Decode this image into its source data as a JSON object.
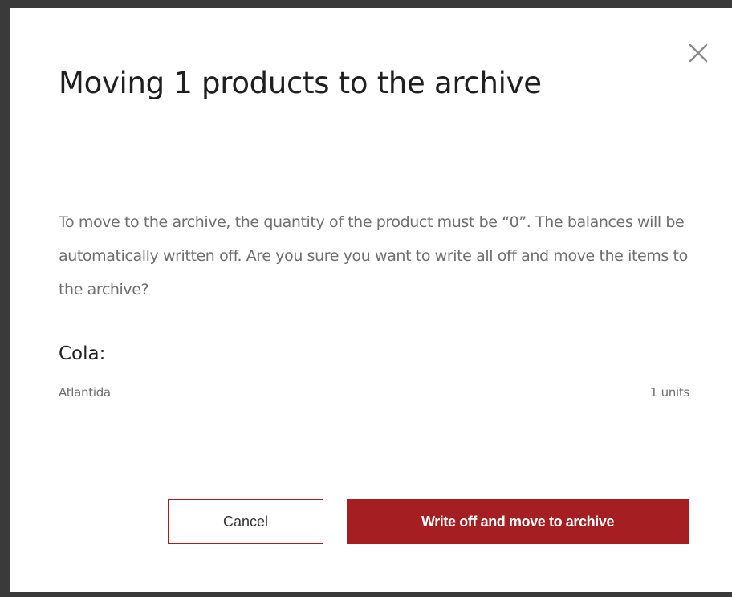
{
  "dialog": {
    "title": "Moving 1 products to the archive",
    "close_icon": "close-icon",
    "message": "To move to the archive, the quantity of the product must be “0”. The balances will be automatically written off. Are you sure you want to write all off and move the items to the archive?",
    "product": {
      "name": "Cola:",
      "stocks": [
        {
          "location": "Atlantida",
          "quantity": "1 units"
        }
      ]
    },
    "buttons": {
      "cancel_label": "Cancel",
      "confirm_label": "Write off and move to archive"
    }
  },
  "colors": {
    "accent": "#a51e22",
    "backdrop": "#3a3a3a",
    "text_primary": "#1f1f1f",
    "text_secondary": "#6e6e6e"
  }
}
